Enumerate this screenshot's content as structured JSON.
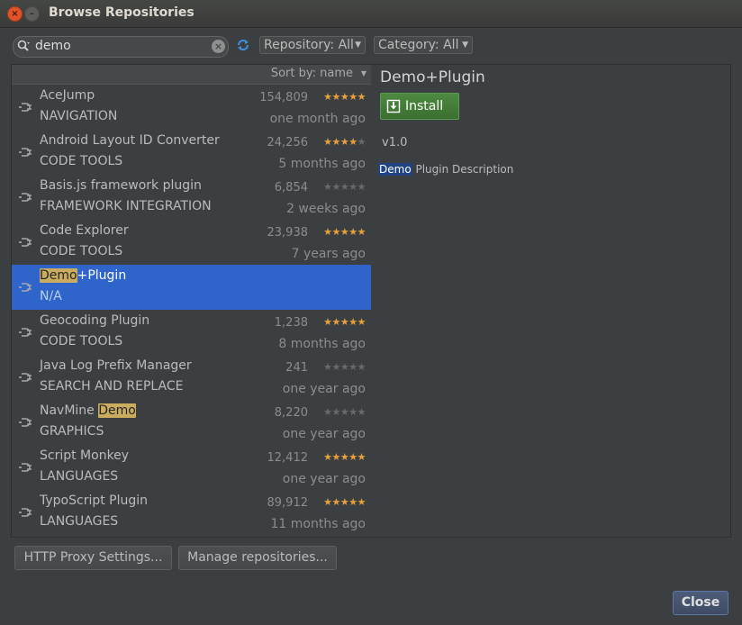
{
  "window": {
    "title": "Browse Repositories"
  },
  "toolbar": {
    "search_value": "demo",
    "repository_label": "Repository: All",
    "category_label": "Category: All"
  },
  "list": {
    "sort_label": "Sort by: name",
    "plugins": [
      {
        "name": "AceJump",
        "name_hl": "",
        "name_rest": "",
        "category": "NAVIGATION",
        "downloads": "154,809",
        "rating": 4.5,
        "date": "one month ago"
      },
      {
        "name": "Android Layout ID Converter",
        "name_hl": "",
        "name_rest": "",
        "category": "CODE TOOLS",
        "downloads": "24,256",
        "rating": 4,
        "date": "5 months ago"
      },
      {
        "name": "Basis.js framework plugin",
        "name_hl": "",
        "name_rest": "",
        "category": "FRAMEWORK INTEGRATION",
        "downloads": "6,854",
        "rating": 0,
        "date": "2 weeks ago"
      },
      {
        "name": "Code Explorer",
        "name_hl": "",
        "name_rest": "",
        "category": "CODE TOOLS",
        "downloads": "23,938",
        "rating": 4.5,
        "date": "7 years ago"
      },
      {
        "name": "",
        "name_hl": "Demo",
        "name_rest": "+Plugin",
        "category": "N/A",
        "downloads": "",
        "rating": null,
        "date": "",
        "selected": true
      },
      {
        "name": "Geocoding Plugin",
        "name_hl": "",
        "name_rest": "",
        "category": "CODE TOOLS",
        "downloads": "1,238",
        "rating": 5,
        "date": "8 months ago"
      },
      {
        "name": "Java Log Prefix Manager",
        "name_hl": "",
        "name_rest": "",
        "category": "SEARCH AND REPLACE",
        "downloads": "241",
        "rating": 0,
        "date": "one year ago"
      },
      {
        "name": "NavMine ",
        "name_hl": "Demo",
        "name_rest": "",
        "category": "GRAPHICS",
        "downloads": "8,220",
        "rating": 0,
        "date": "one year ago",
        "hl_after": true
      },
      {
        "name": "Script Monkey",
        "name_hl": "",
        "name_rest": "",
        "category": "LANGUAGES",
        "downloads": "12,412",
        "rating": 5,
        "date": "one year ago"
      },
      {
        "name": "TypoScript Plugin",
        "name_hl": "",
        "name_rest": "",
        "category": "LANGUAGES",
        "downloads": "89,912",
        "rating": 5,
        "date": "11 months ago"
      }
    ]
  },
  "detail": {
    "title": "Demo+Plugin",
    "install_label": "Install",
    "version": "v1.0",
    "description_hl": "Demo",
    "description_rest": " Plugin Description"
  },
  "buttons": {
    "http_proxy": "HTTP Proxy Settings...",
    "manage_repos": "Manage repositories...",
    "close": "Close"
  },
  "colors": {
    "background": "#3c3f41",
    "selection": "#2f65ca",
    "highlight": "#c9ac5e",
    "star": "#e8a13a",
    "install_green": "#4d8a41"
  },
  "icons": [
    "close-icon",
    "minimize-icon",
    "search-icon",
    "clear-icon",
    "refresh-icon",
    "plug-icon",
    "star-icon",
    "download-icon"
  ]
}
